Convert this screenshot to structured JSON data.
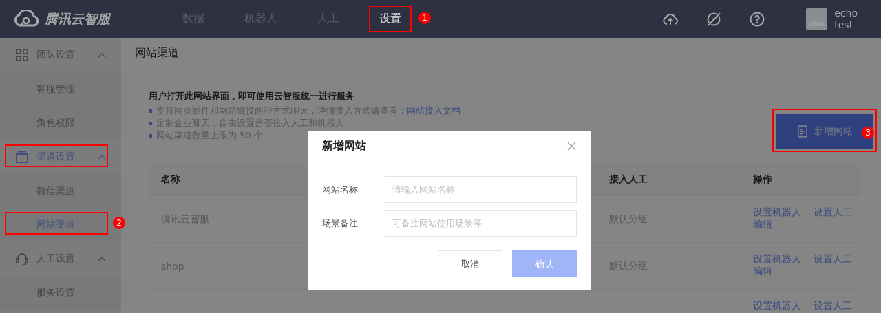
{
  "header": {
    "brand": "腾讯云智服",
    "nav": [
      {
        "label": "数据",
        "selected": false
      },
      {
        "label": "机器人",
        "selected": false
      },
      {
        "label": "人工",
        "selected": false
      },
      {
        "label": "设置",
        "selected": true,
        "marked": true,
        "callout": "1"
      }
    ],
    "user": {
      "name": "echo",
      "role": "test"
    }
  },
  "sidebar": {
    "groups": [
      {
        "kind": "team",
        "label": "团队设置",
        "active": false,
        "expanded": true,
        "marked": false,
        "children": [
          {
            "label": "客服管理",
            "selected": false,
            "marked": false
          },
          {
            "label": "角色权限",
            "selected": false,
            "marked": false
          }
        ]
      },
      {
        "kind": "channel",
        "label": "渠道设置",
        "active": true,
        "expanded": true,
        "marked": true,
        "children": [
          {
            "label": "微信渠道",
            "selected": false,
            "marked": false
          },
          {
            "label": "网站渠道",
            "selected": true,
            "marked": true,
            "callout": "2"
          }
        ]
      },
      {
        "kind": "agent",
        "label": "人工设置",
        "active": false,
        "expanded": true,
        "marked": false,
        "children": [
          {
            "label": "服务设置",
            "selected": false,
            "marked": false
          }
        ]
      }
    ]
  },
  "page": {
    "title": "网站渠道",
    "intro": "用户打开此网站界面，即可使用云智服统一进行服务",
    "notes": [
      {
        "text": "支持网页插件和网站链接两种方式聊天，详情接入方式请查看：",
        "link": "网站接入文档"
      },
      {
        "text": "定制企业聊天，自由设置是否接入人工和机器人"
      },
      {
        "text": "网站渠道数量上限为 50 个"
      }
    ],
    "add_button": {
      "label": "新增网站",
      "marked": true,
      "callout": "3"
    }
  },
  "table": {
    "columns": {
      "name": "名称",
      "access": "接入人工",
      "actions": "操作"
    },
    "rows": [
      {
        "name": "腾讯云智服",
        "access": "默认分组",
        "actions": [
          "设置机器人",
          "设置人工",
          "编辑"
        ]
      },
      {
        "name": "shop",
        "access": "默认分组",
        "actions": [
          "设置机器人",
          "设置人工",
          "编辑"
        ]
      },
      {
        "actions": [
          "设置机器人",
          "设置人工"
        ]
      }
    ]
  },
  "modal": {
    "title": "新增网站",
    "fields": [
      {
        "label": "网站名称",
        "placeholder": "请输入网站名称"
      },
      {
        "label": "场景备注",
        "placeholder": "可备注网站使用场景等"
      }
    ],
    "buttons": [
      {
        "label": "取消",
        "kind": "secondary",
        "disabled": false
      },
      {
        "label": "确认",
        "kind": "primary",
        "disabled": true
      }
    ]
  }
}
